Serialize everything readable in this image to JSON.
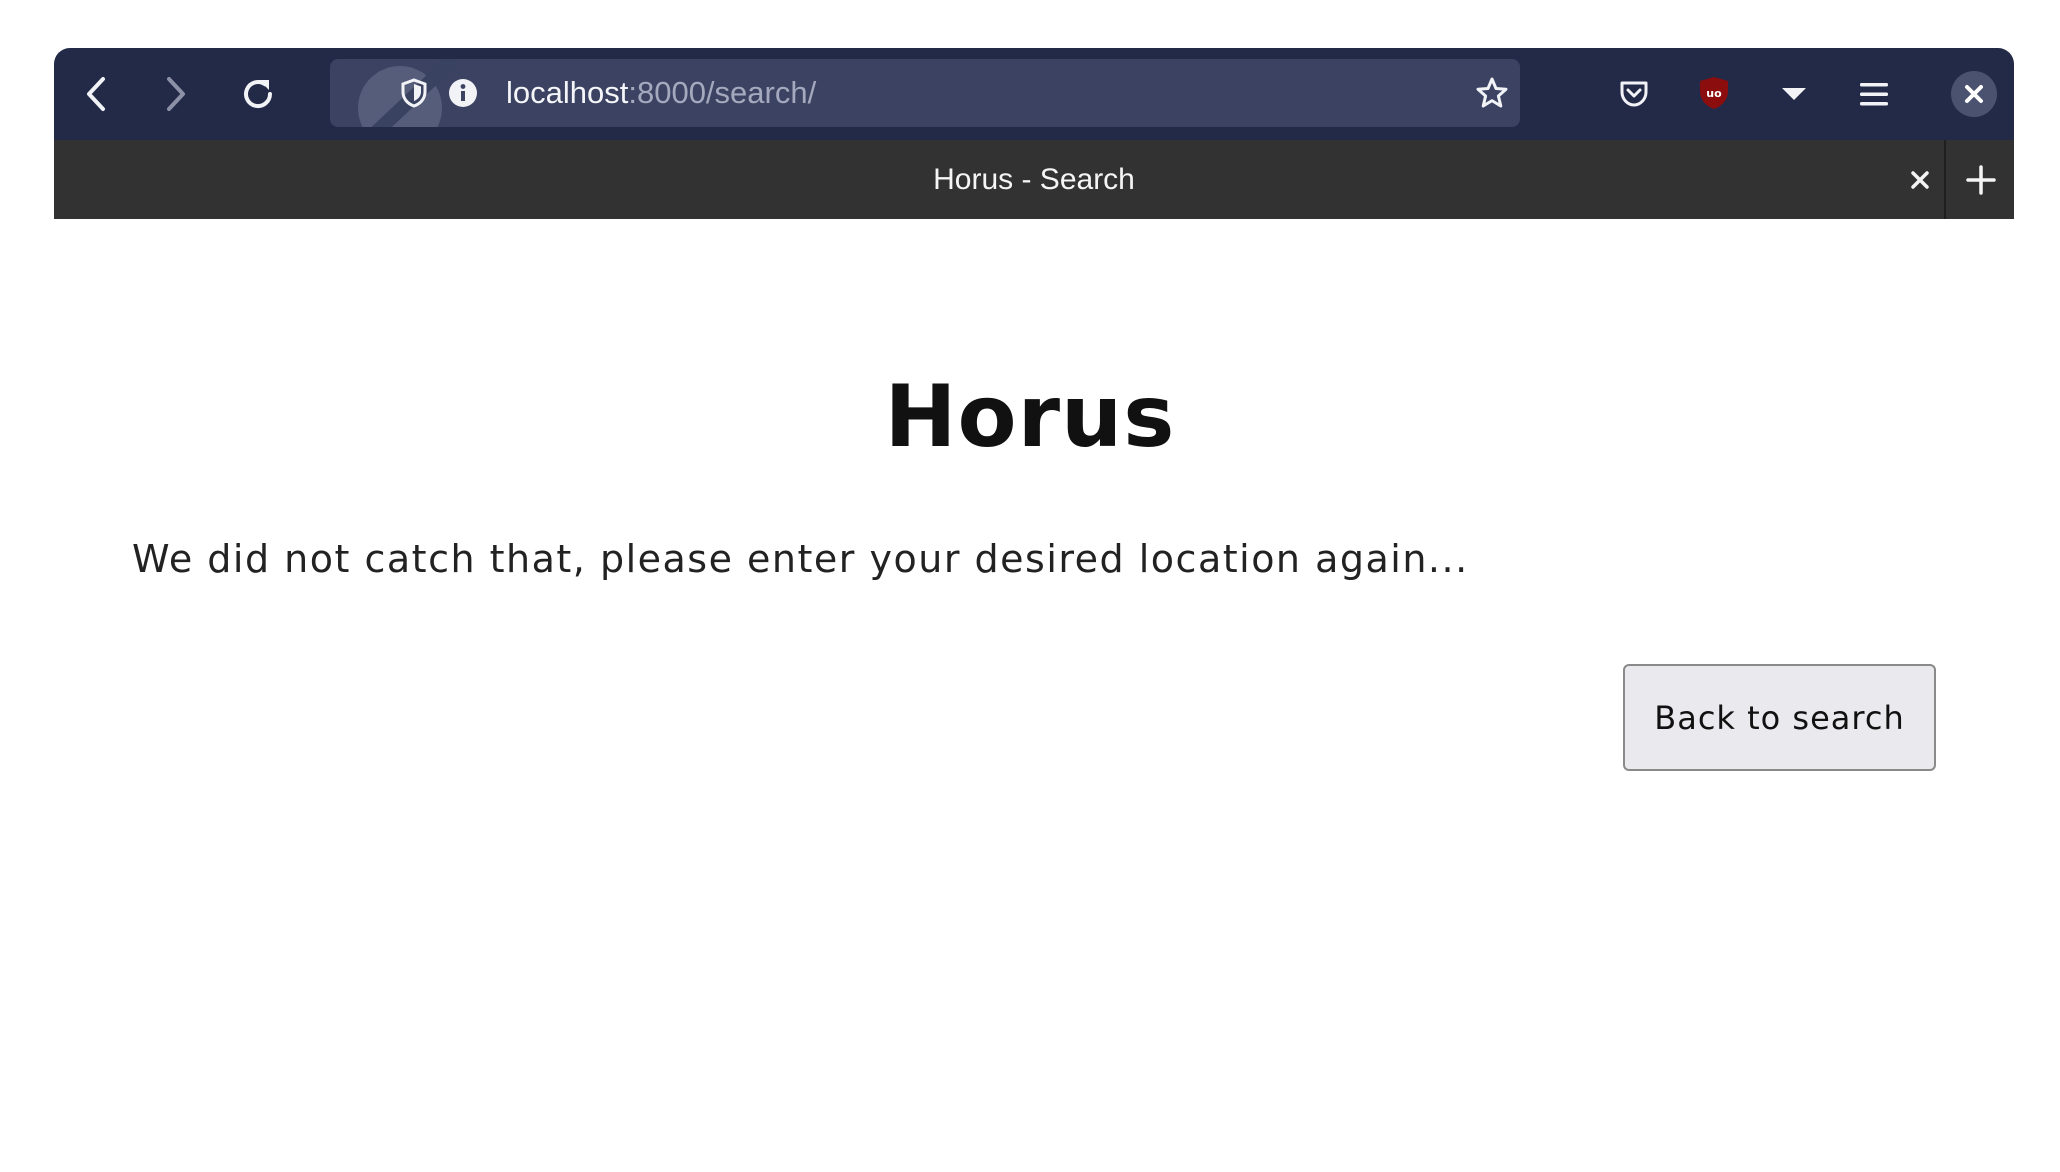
{
  "browser": {
    "url_host": "localhost",
    "url_path": ":8000/search/",
    "tab_title": "Horus - Search",
    "icons": {
      "back": "back-arrow-icon",
      "forward": "forward-arrow-icon",
      "reload": "reload-icon",
      "tracking": "tracking-protection-shield-icon",
      "info": "site-info-icon",
      "bookmark": "bookmark-star-icon",
      "pocket": "pocket-icon",
      "ublock": "ublock-origin-icon",
      "dropdown": "dropdown-arrow-icon",
      "menu": "hamburger-menu-icon",
      "close_window": "close-window-icon",
      "close_tab": "close-tab-icon",
      "new_tab": "new-tab-plus-icon"
    },
    "colors": {
      "toolbar": "#232a48",
      "urlbar": "#3b4262",
      "tabbar": "#323232"
    }
  },
  "page": {
    "heading": "Horus",
    "message": "We did not catch that, please enter your desired location again...",
    "back_button": "Back to search"
  }
}
